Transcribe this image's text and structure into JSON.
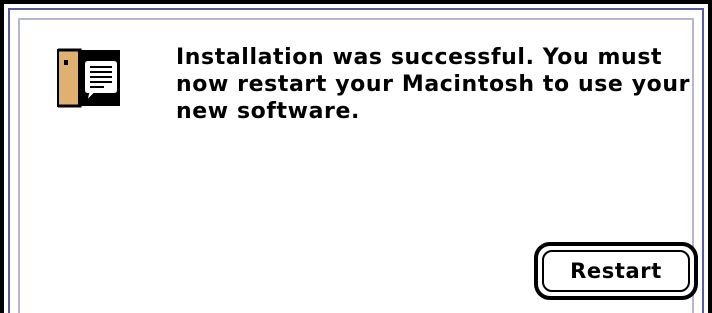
{
  "dialog": {
    "icon": "installer-speech-face-icon",
    "message": "Installation was successful.  You must now restart your Macintosh to use your new software.",
    "restart_label": "Restart"
  },
  "colors": {
    "frame": "#000000",
    "frame_accent": "#5a5aa6",
    "icon_face": "#e0b070",
    "background": "#ffffff"
  }
}
